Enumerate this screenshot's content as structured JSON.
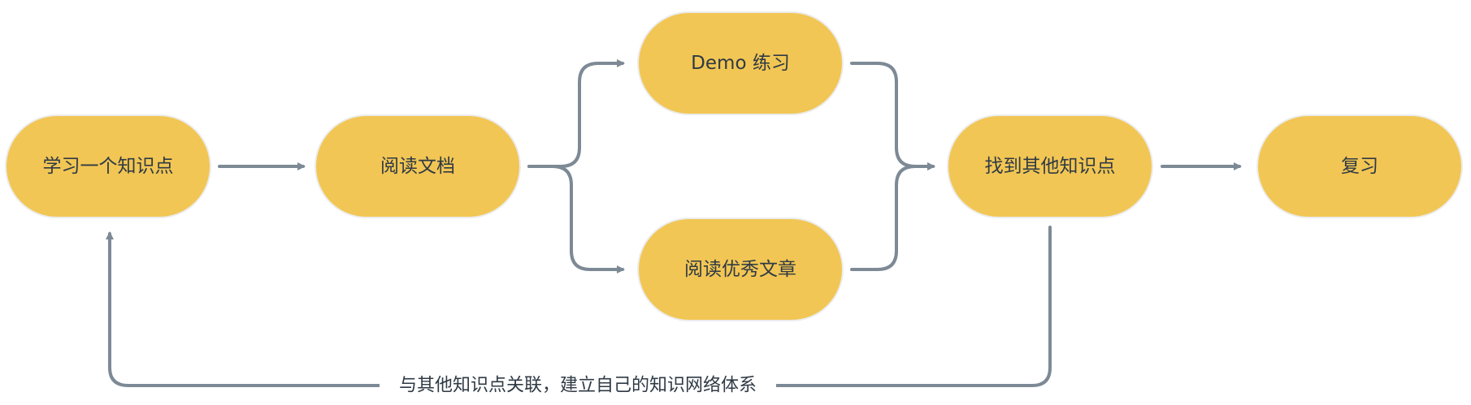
{
  "colors": {
    "node_fill": "#f2c654",
    "connector": "#7d8a96",
    "text": "#2f3a45"
  },
  "nodes": {
    "learn": "学习一个知识点",
    "read_docs": "阅读文档",
    "demo": "Demo 练习",
    "read_articles": "阅读优秀文章",
    "find_others": "找到其他知识点",
    "review": "复习"
  },
  "edges": {
    "feedback_label": "与其他知识点关联，建立自己的知识网络体系"
  }
}
